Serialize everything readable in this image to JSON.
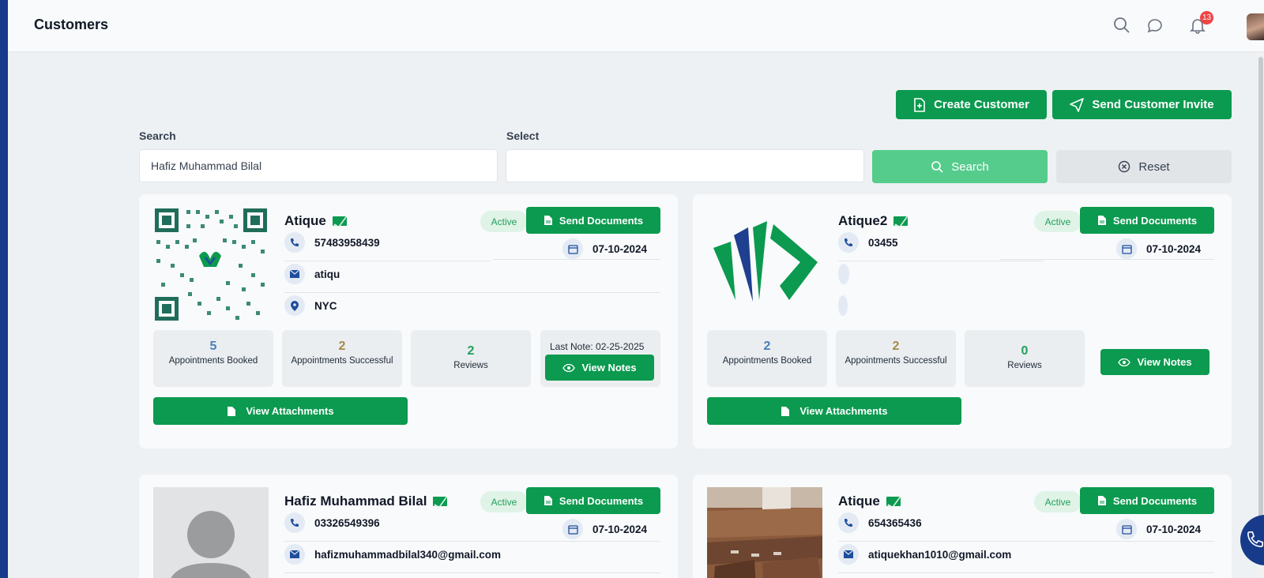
{
  "header": {
    "title": "Customers",
    "notification_count": "13"
  },
  "actions": {
    "create_label": "Create Customer",
    "invite_label": "Send Customer Invite"
  },
  "filters": {
    "search_label": "Search",
    "search_value": "Hafiz Muhammad Bilal",
    "select_label": "Select",
    "search_button": "Search",
    "reset_button": "Reset"
  },
  "cards": [
    {
      "name": "Atique",
      "status": "Active",
      "send_label": "Send Documents",
      "phone": "57483958439",
      "date": "07-10-2024",
      "email": "atiqu",
      "location": "NYC",
      "stats": [
        {
          "value": "5",
          "label": "Appointments Booked"
        },
        {
          "value": "2",
          "label": "Appointments Successful"
        },
        {
          "value": "2",
          "label": "Reviews"
        }
      ],
      "last_note": "Last Note: 02-25-2025",
      "view_notes": "View Notes",
      "attachments": "View Attachments"
    },
    {
      "name": "Atique2",
      "status": "Active",
      "send_label": "Send Documents",
      "phone": "03455",
      "date": "07-10-2024",
      "stats": [
        {
          "value": "2",
          "label": "Appointments Booked"
        },
        {
          "value": "2",
          "label": "Appointments Successful"
        },
        {
          "value": "0",
          "label": "Reviews"
        }
      ],
      "view_notes": "View Notes",
      "attachments": "View Attachments"
    },
    {
      "name": "Hafiz Muhammad Bilal",
      "status": "Active",
      "send_label": "Send Documents",
      "phone": "03326549396",
      "date": "07-10-2024",
      "email": "hafizmuhammadbilal340@gmail.com"
    },
    {
      "name": "Atique",
      "status": "Active",
      "send_label": "Send Documents",
      "phone": "654365436",
      "date": "07-10-2024",
      "email": "atiquekhan1010@gmail.com"
    }
  ],
  "colors": {
    "primary": "#0b9a4f",
    "sidebar": "#173a8a",
    "stat_blue": "#4a7fb8",
    "stat_gold": "#a58a4a",
    "stat_green": "#22a05c"
  }
}
